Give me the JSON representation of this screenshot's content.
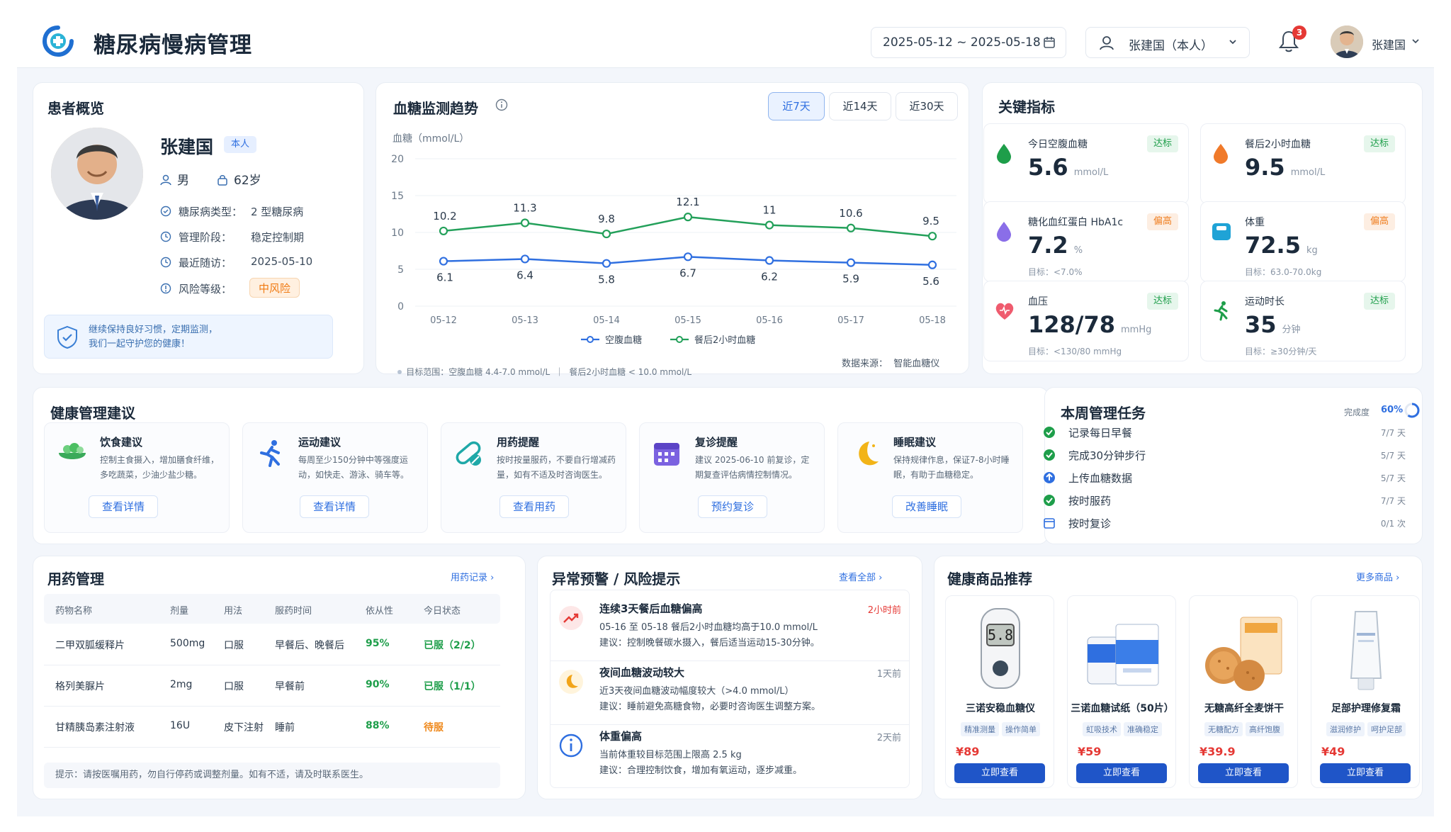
{
  "header": {
    "title": "糖尿病慢病管理",
    "date_range": "2025-05-12 ~ 2025-05-18",
    "user_select": "张建国（本人）",
    "notif_count": "3",
    "user_name": "张建国"
  },
  "patient": {
    "section_title": "患者概览",
    "name": "张建国",
    "tag": "本人",
    "gender": "男",
    "age": "62岁",
    "rows": [
      {
        "label": "糖尿病类型：",
        "value": "2 型糖尿病"
      },
      {
        "label": "管理阶段：",
        "value": "稳定控制期"
      },
      {
        "label": "最近随访：",
        "value": "2025-05-10"
      },
      {
        "label": "风险等级：",
        "value": "中风险"
      }
    ],
    "tip_line1": "继续保持良好习惯，定期监测，",
    "tip_line2": "我们一起守护您的健康！"
  },
  "trend": {
    "section_title": "血糖监测趋势",
    "tabs": [
      "近7天",
      "近14天",
      "近30天"
    ],
    "active_tab": 0,
    "footer_left": "目标范围：空腹血糖 4.4-7.0 mmol/L  ｜  餐后2小时血糖 < 10.0 mmol/L",
    "footer_right": "数据来源：  智能血糖仪"
  },
  "chart_data": {
    "type": "line",
    "ylabel": "血糖（mmol/L）",
    "ylim": [
      0,
      20
    ],
    "yticks": [
      0,
      5,
      10,
      15,
      20
    ],
    "categories": [
      "05-12",
      "05-13",
      "05-14",
      "05-15",
      "05-16",
      "05-17",
      "05-18"
    ],
    "grid": true,
    "legend": "bottom-center",
    "series": [
      {
        "name": "空腹血糖",
        "color": "#2f6fe0",
        "values": [
          6.1,
          6.4,
          5.8,
          6.7,
          6.2,
          5.9,
          5.6
        ]
      },
      {
        "name": "餐后2小时血糖",
        "color": "#23a05a",
        "values": [
          10.2,
          11.3,
          9.8,
          12.1,
          11.0,
          10.6,
          9.5
        ]
      }
    ]
  },
  "metrics": {
    "section_title": "关键指标",
    "items": [
      {
        "title": "今日空腹血糖",
        "value": "5.6",
        "unit": "mmol/L",
        "goal": "",
        "badge": "达标",
        "status": "ok",
        "icon": "drop-green-icon"
      },
      {
        "title": "餐后2小时血糖",
        "value": "9.5",
        "unit": "mmol/L",
        "goal": "",
        "badge": "达标",
        "status": "ok",
        "icon": "drop-orange-icon"
      },
      {
        "title": "糖化血红蛋白 HbA1c",
        "value": "7.2",
        "unit": "%",
        "goal": "目标：<7.0%",
        "badge": "偏高",
        "status": "hi",
        "icon": "drop-purple-icon"
      },
      {
        "title": "体重",
        "value": "72.5",
        "unit": "kg",
        "goal": "目标：63.0-70.0kg",
        "badge": "偏高",
        "status": "hi",
        "icon": "scale-icon"
      },
      {
        "title": "血压",
        "value": "128/78",
        "unit": "mmHg",
        "goal": "目标：<130/80 mmHg",
        "badge": "达标",
        "status": "ok",
        "icon": "heart-icon"
      },
      {
        "title": "运动时长",
        "value": "35",
        "unit": "分钟",
        "goal": "目标：≥30分钟/天",
        "badge": "达标",
        "status": "ok",
        "icon": "running-icon"
      }
    ]
  },
  "advice": {
    "section_title": "健康管理建议",
    "items": [
      {
        "title": "饮食建议",
        "desc": "控制主食摄入，增加膳食纤维，多吃蔬菜，少油少盐少糖。",
        "button": "查看详情"
      },
      {
        "title": "运动建议",
        "desc": "每周至少150分钟中等强度运动，如快走、游泳、骑车等。",
        "button": "查看详情"
      },
      {
        "title": "用药提醒",
        "desc": "按时按量服药，不要自行增减药量，如有不适及时咨询医生。",
        "button": "查看用药"
      },
      {
        "title": "复诊提醒",
        "desc": "建议 2025-06-10 前复诊，定期复查评估病情控制情况。",
        "button": "预约复诊"
      },
      {
        "title": "睡眠建议",
        "desc": "保持规律作息，保证7-8小时睡眠，有助于血糖稳定。",
        "button": "改善睡眠"
      }
    ]
  },
  "tasks": {
    "section_title": "本周管理任务",
    "progress_label": "完成度",
    "progress_value": "60%",
    "progress": 0.6,
    "items": [
      {
        "name": "记录每日早餐",
        "count": "7/7 天",
        "icon": "check-icon"
      },
      {
        "name": "完成30分钟步行",
        "count": "5/7 天",
        "icon": "check-icon"
      },
      {
        "name": "上传血糖数据",
        "count": "5/7 天",
        "icon": "upload-icon"
      },
      {
        "name": "按时服药",
        "count": "7/7 天",
        "icon": "check-icon"
      },
      {
        "name": "按时复诊",
        "count": "0/1 次",
        "icon": "calendar-icon"
      }
    ]
  },
  "medication": {
    "section_title": "用药管理",
    "link": "用药记录",
    "columns": [
      "药物名称",
      "剂量",
      "用法",
      "服药时间",
      "依从性",
      "今日状态"
    ],
    "rows": [
      [
        "二甲双胍缓释片",
        "500mg",
        "口服",
        "早餐后、晚餐后",
        "95%",
        "已服（2/2）"
      ],
      [
        "格列美脲片",
        "2mg",
        "口服",
        "早餐前",
        "90%",
        "已服（1/1）"
      ],
      [
        "甘精胰岛素注射液",
        "16U",
        "皮下注射",
        "睡前",
        "88%",
        "待服"
      ]
    ],
    "note": "提示：请按医嘱用药，勿自行停药或调整剂量。如有不适，请及时联系医生。"
  },
  "alerts": {
    "section_title": "异常预警 / 风险提示",
    "link": "查看全部",
    "items": [
      {
        "title": "连续3天餐后血糖偏高",
        "line1": "05-16 至 05-18 餐后2小时血糖均高于10.0 mmol/L",
        "line2": "建议：控制晚餐碳水摄入，餐后适当运动15-30分钟。",
        "time": "2小时前"
      },
      {
        "title": "夜间血糖波动较大",
        "line1": "近3天夜间血糖波动幅度较大（>4.0 mmol/L）",
        "line2": "建议：睡前避免高糖食物，必要时咨询医生调整方案。",
        "time": "1天前"
      },
      {
        "title": "体重偏高",
        "line1": "当前体重较目标范围上限高 2.5 kg",
        "line2": "建议：合理控制饮食，增加有氧运动，逐步减重。",
        "time": "2天前"
      }
    ]
  },
  "products": {
    "section_title": "健康商品推荐",
    "link": "更多商品",
    "items": [
      {
        "name": "三诺安稳血糖仪",
        "tags": [
          "精准测量",
          "操作简单"
        ],
        "price": "¥89",
        "button": "立即查看",
        "meter_reading": "5.8"
      },
      {
        "name": "三诺血糖试纸（50片）",
        "tags": [
          "虹吸技术",
          "准确稳定"
        ],
        "price": "¥59",
        "button": "立即查看"
      },
      {
        "name": "无糖高纤全麦饼干",
        "tags": [
          "无糖配方",
          "高纤饱腹"
        ],
        "price": "¥39.9",
        "button": "立即查看"
      },
      {
        "name": "足部护理修复霜",
        "tags": [
          "滋润修护",
          "呵护足部"
        ],
        "price": "¥49",
        "button": "立即查看"
      }
    ]
  }
}
